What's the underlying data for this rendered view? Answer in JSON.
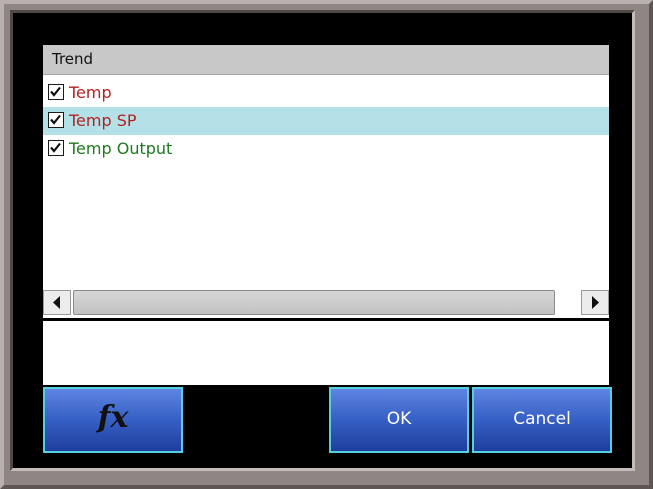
{
  "panel": {
    "header_title": "Trend"
  },
  "list": {
    "items": [
      {
        "label": "Temp",
        "checked": true,
        "color": "#b22222",
        "selected": false
      },
      {
        "label": "Temp SP",
        "checked": true,
        "color": "#b22222",
        "selected": true
      },
      {
        "label": "Temp Output",
        "checked": true,
        "color": "#1e7a1e",
        "selected": false
      }
    ],
    "selected_row_color": "#b4e1e8"
  },
  "scrollbar": {
    "left_icon": "triangle-left-icon",
    "right_icon": "triangle-right-icon"
  },
  "buttons": {
    "fx_label": "fx",
    "ok_label": "OK",
    "cancel_label": "Cancel",
    "button_color": "#3a63c8",
    "button_border_color": "#56cfe0"
  },
  "frame": {
    "bezel_color": "#8f8583",
    "screen_color": "#000000"
  }
}
